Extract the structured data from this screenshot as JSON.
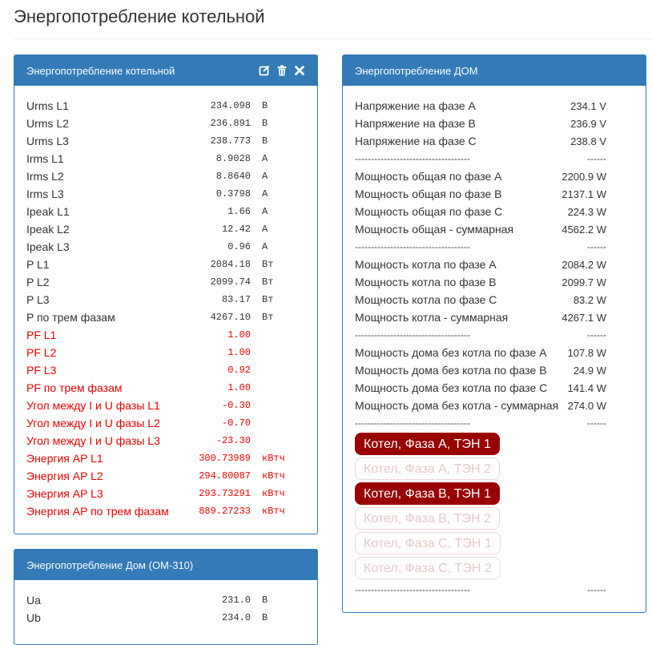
{
  "page": {
    "title": "Энергопотребление котельной"
  },
  "boiler_panel": {
    "title": "Энергопотребление котельной",
    "rows": [
      {
        "label": "Urms L1",
        "value": "234.098",
        "unit": "В",
        "red": false
      },
      {
        "label": "Urms L2",
        "value": "236.891",
        "unit": "В",
        "red": false
      },
      {
        "label": "Urms L3",
        "value": "238.773",
        "unit": "В",
        "red": false
      },
      {
        "label": "Irms L1",
        "value": "8.9028",
        "unit": "А",
        "red": false
      },
      {
        "label": "Irms L2",
        "value": "8.8640",
        "unit": "А",
        "red": false
      },
      {
        "label": "Irms L3",
        "value": "0.3798",
        "unit": "А",
        "red": false
      },
      {
        "label": "Ipeak L1",
        "value": "1.66",
        "unit": "А",
        "red": false
      },
      {
        "label": "Ipeak L2",
        "value": "12.42",
        "unit": "А",
        "red": false
      },
      {
        "label": "Ipeak L3",
        "value": "0.96",
        "unit": "А",
        "red": false
      },
      {
        "label": "P L1",
        "value": "2084.18",
        "unit": "Вт",
        "red": false
      },
      {
        "label": "P L2",
        "value": "2099.74",
        "unit": "Вт",
        "red": false
      },
      {
        "label": "P L3",
        "value": "83.17",
        "unit": "Вт",
        "red": false
      },
      {
        "label": "P по трем фазам",
        "value": "4267.10",
        "unit": "Вт",
        "red": false
      },
      {
        "label": "PF L1",
        "value": "1.00",
        "unit": "",
        "red": true
      },
      {
        "label": "PF L2",
        "value": "1.00",
        "unit": "",
        "red": true
      },
      {
        "label": "PF L3",
        "value": "0.92",
        "unit": "",
        "red": true
      },
      {
        "label": "PF по трем фазам",
        "value": "1.00",
        "unit": "",
        "red": true
      },
      {
        "label": "Угол между I и U фазы L1",
        "value": "-0.30",
        "unit": "",
        "red": true
      },
      {
        "label": "Угол между I и U фазы L2",
        "value": "-0.70",
        "unit": "",
        "red": true
      },
      {
        "label": "Угол между I и U фазы L3",
        "value": "-23.30",
        "unit": "",
        "red": true
      },
      {
        "label": "Энергия AP L1",
        "value": "300.73989",
        "unit": "кВтч",
        "red": true
      },
      {
        "label": "Энергия AP L2",
        "value": "294.80087",
        "unit": "кВтч",
        "red": true
      },
      {
        "label": "Энергия AP L3",
        "value": "293.73291",
        "unit": "кВтч",
        "red": true
      },
      {
        "label": "Энергия AP по трем фазам",
        "value": "889.27233",
        "unit": "кВтч",
        "red": true
      }
    ]
  },
  "home_om_panel": {
    "title": "Энергопотребление Дом (ОМ-310)",
    "rows": [
      {
        "label": "Ua",
        "value": "231.0",
        "unit": "В"
      },
      {
        "label": "Ub",
        "value": "234.0",
        "unit": "В"
      }
    ]
  },
  "home_panel": {
    "title": "Энергопотребление ДОМ",
    "separator_left": "------------------------------------",
    "separator_right": "------",
    "rows": [
      {
        "label": "Напряжение на фазе A",
        "value": "234.1 V"
      },
      {
        "label": "Напряжение на фазе B",
        "value": "236.9 V"
      },
      {
        "label": "Напряжение на фазе C",
        "value": "238.8 V"
      },
      {
        "sep": true
      },
      {
        "label": "Мощность общая по фазе A",
        "value": "2200.9 W"
      },
      {
        "label": "Мощность общая по фазе B",
        "value": "2137.1 W"
      },
      {
        "label": "Мощность общая по фазе C",
        "value": "224.3 W"
      },
      {
        "label": "Мощность общая - суммарная",
        "value": "4562.2 W"
      },
      {
        "sep": true
      },
      {
        "label": "Мощность котла по фазе A",
        "value": "2084.2 W"
      },
      {
        "label": "Мощность котла по фазе B",
        "value": "2099.7 W"
      },
      {
        "label": "Мощность котла по фазе C",
        "value": "83.2 W"
      },
      {
        "label": "Мощность котла - суммарная",
        "value": "4267.1 W"
      },
      {
        "sep": true
      },
      {
        "label": "Мощность дома без котла по фазе A",
        "value": "107.8 W"
      },
      {
        "label": "Мощность дома без котла по фазе B",
        "value": "24.9 W"
      },
      {
        "label": "Мощность дома без котла по фазе C",
        "value": "141.4 W"
      },
      {
        "label": "Мощность дома без котла - суммарная",
        "value": "274.0 W"
      },
      {
        "sep": true
      }
    ],
    "heater_buttons": [
      {
        "label": "Котел, Фаза A, ТЭН 1",
        "active": true
      },
      {
        "label": "Котел, Фаза A, ТЭН 2",
        "active": false
      },
      {
        "label": "Котел, Фаза B, ТЭН 1",
        "active": true
      },
      {
        "label": "Котел, Фаза B, ТЭН 2",
        "active": false
      },
      {
        "label": "Котел, Фаза C, ТЭН 1",
        "active": false
      },
      {
        "label": "Котел, Фаза C, ТЭН 2",
        "active": false
      }
    ]
  },
  "icons": {
    "edit": "edit-icon",
    "delete": "trash-icon",
    "close": "close-icon"
  },
  "colors": {
    "panel_blue": "#337ab7",
    "alert_red": "#ee0000",
    "heater_on": "#990000"
  }
}
